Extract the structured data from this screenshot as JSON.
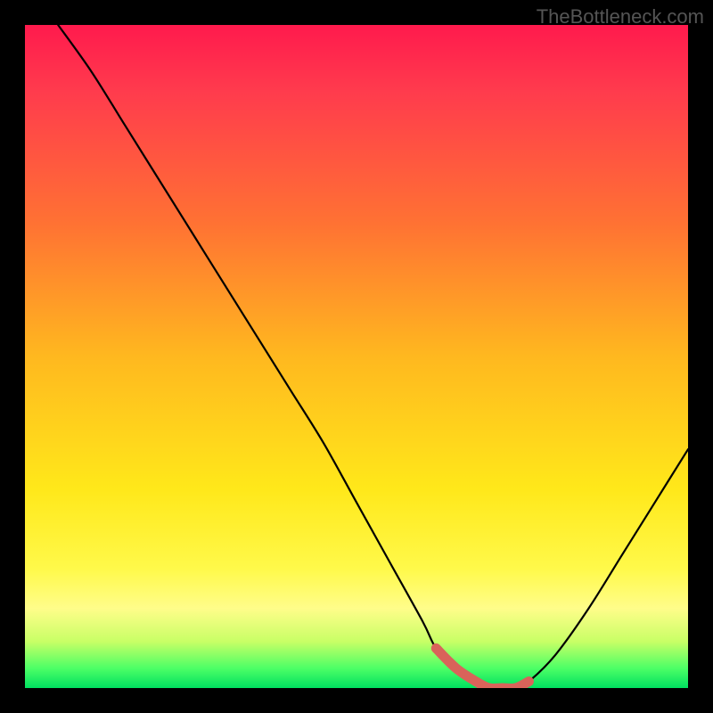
{
  "watermark": "TheBottleneck.com",
  "chart_data": {
    "type": "line",
    "title": "",
    "xlabel": "",
    "ylabel": "",
    "xlim": [
      0,
      100
    ],
    "ylim": [
      0,
      100
    ],
    "series": [
      {
        "name": "bottleneck-curve",
        "x": [
          5,
          10,
          15,
          20,
          25,
          30,
          35,
          40,
          45,
          50,
          55,
          60,
          62,
          65,
          68,
          70,
          72,
          74,
          76,
          80,
          85,
          90,
          95,
          100
        ],
        "values": [
          100,
          93,
          85,
          77,
          69,
          61,
          53,
          45,
          37,
          28,
          19,
          10,
          6,
          3,
          1,
          0,
          0,
          0,
          1,
          5,
          12,
          20,
          28,
          36
        ]
      }
    ],
    "highlight": {
      "name": "optimal-range",
      "x": [
        62,
        65,
        68,
        70,
        72,
        74,
        76
      ],
      "values": [
        6,
        3,
        1,
        0,
        0,
        0,
        1
      ],
      "color": "#d9635a"
    },
    "gradient_stops": [
      {
        "pos": 0,
        "color": "#ff1a4d"
      },
      {
        "pos": 30,
        "color": "#ff7233"
      },
      {
        "pos": 50,
        "color": "#ffb81f"
      },
      {
        "pos": 82,
        "color": "#fff94a"
      },
      {
        "pos": 100,
        "color": "#00e060"
      }
    ]
  }
}
